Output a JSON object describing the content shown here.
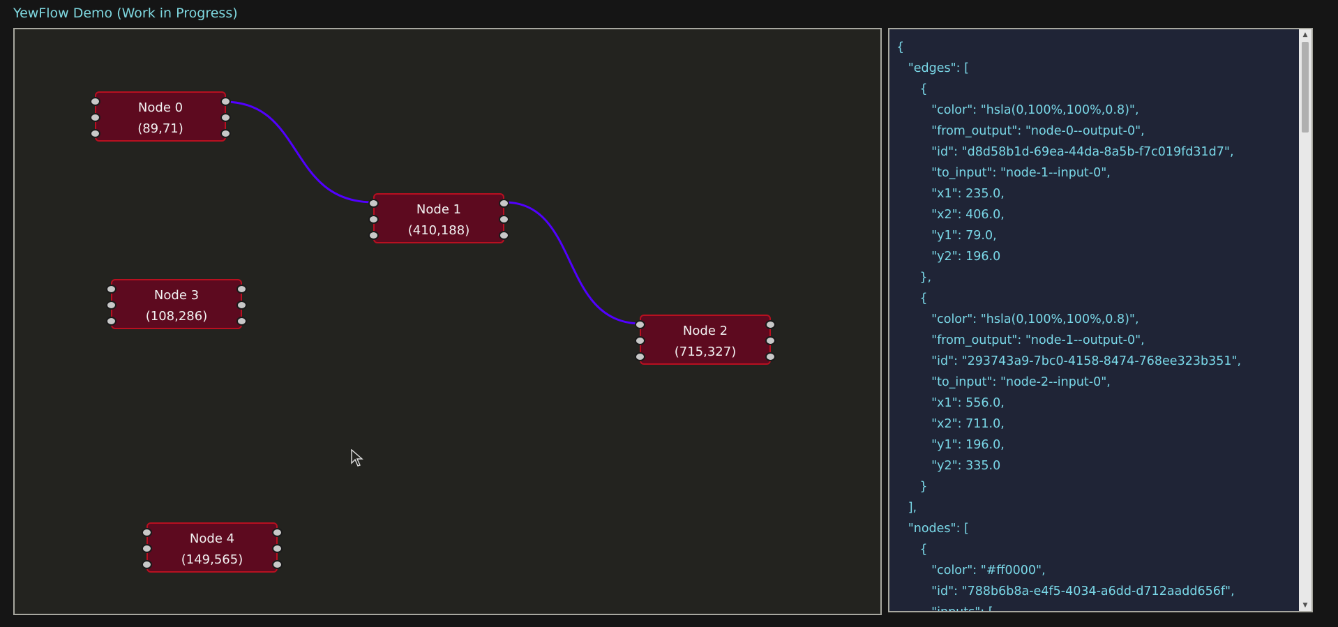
{
  "app": {
    "title": "YewFlow Demo (Work in Progress)"
  },
  "colors": {
    "edge": "#5200ff",
    "node_fill": "#5d0a1f",
    "node_border": "#b81020",
    "json_text": "#7ad8e8"
  },
  "nodes": [
    {
      "title": "Node 0",
      "coords": "(89,71)"
    },
    {
      "title": "Node 1",
      "coords": "(410,188)"
    },
    {
      "title": "Node 2",
      "coords": "(715,327)"
    },
    {
      "title": "Node 3",
      "coords": "(108,286)"
    },
    {
      "title": "Node 4",
      "coords": "(149,565)"
    }
  ],
  "json_panel": {
    "lines": [
      "{",
      "   \"edges\": [",
      "      {",
      "         \"color\": \"hsla(0,100%,100%,0.8)\",",
      "         \"from_output\": \"node-0--output-0\",",
      "         \"id\": \"d8d58b1d-69ea-44da-8a5b-f7c019fd31d7\",",
      "         \"to_input\": \"node-1--input-0\",",
      "         \"x1\": 235.0,",
      "         \"x2\": 406.0,",
      "         \"y1\": 79.0,",
      "         \"y2\": 196.0",
      "      },",
      "      {",
      "         \"color\": \"hsla(0,100%,100%,0.8)\",",
      "         \"from_output\": \"node-1--output-0\",",
      "         \"id\": \"293743a9-7bc0-4158-8474-768ee323b351\",",
      "         \"to_input\": \"node-2--input-0\",",
      "         \"x1\": 556.0,",
      "         \"x2\": 711.0,",
      "         \"y1\": 196.0,",
      "         \"y2\": 335.0",
      "      }",
      "   ],",
      "   \"nodes\": [",
      "      {",
      "         \"color\": \"#ff0000\",",
      "         \"id\": \"788b6b8a-e4f5-4034-a6dd-d712aadd656f\",",
      "         \"inputs\": ["
    ]
  },
  "icons": {
    "cursor": "arrow-cursor-icon",
    "scroll_up": "triangle-up-icon",
    "scroll_down": "triangle-down-icon"
  }
}
